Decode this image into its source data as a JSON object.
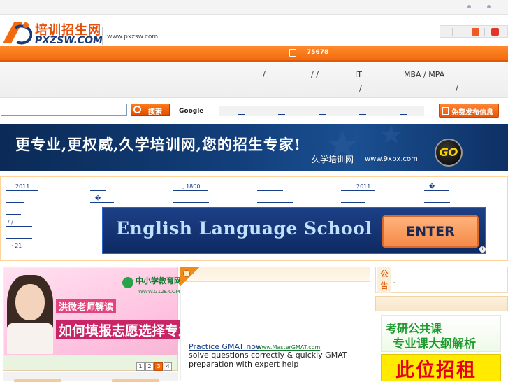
{
  "header": {
    "logo_cn": "培训招生网",
    "logo_en": "PXZSW.COM",
    "url": "www.pxzsw.com"
  },
  "nav": {
    "phone": "75678"
  },
  "categories": {
    "slash1": "/",
    "slash2": "/ /",
    "it": "IT",
    "mba": "MBA / MPA",
    "slash3": "/",
    "slash4": "/"
  },
  "search": {
    "input_value": "",
    "button_label": "搜索",
    "google_label": "Google",
    "publish_label": "免费发布信息"
  },
  "banner": {
    "slogan": "更专业,更权威,久学培训网,您的招生专家!",
    "brand": "久学培训网",
    "url": "www.9xpx.com",
    "go": "GO"
  },
  "links": {
    "r1": [
      "2011",
      "",
      ", 1800",
      "",
      "2011",
      "�"
    ],
    "r2": [
      "",
      "�",
      "",
      "",
      "",
      ""
    ],
    "r3": [
      ""
    ],
    "r4": [
      "/ /"
    ],
    "r5": [
      ""
    ],
    "r6": [
      "· 21"
    ]
  },
  "english_ad": {
    "title": "English Language School",
    "cta": "ENTER",
    "info": "i"
  },
  "photo_ad": {
    "logo": "中小学教育网",
    "logo_url": "WWW.G12E.COM",
    "line1": "洪微老师解读",
    "line2": "如何填报志愿选择专业",
    "pages": [
      "1",
      "2",
      "3",
      "4"
    ],
    "active_page": "3"
  },
  "gmat_ad": {
    "title": "Practice GMAT now",
    "url": "www.MasterGMAT.com",
    "desc": "solve questions correctly & quickly GMAT preparation with expert help"
  },
  "notice": {
    "label": "公告",
    "q1": "·",
    "q2": "·"
  },
  "right_ads": {
    "kaoyan_line1": "考研公共课",
    "kaoyan_line2": "专业课大纲解析",
    "rent": "此位招租"
  },
  "colors": {
    "brand_orange": "#f26a0f",
    "brand_blue": "#1b3a78",
    "link": "#1a3f8a"
  }
}
